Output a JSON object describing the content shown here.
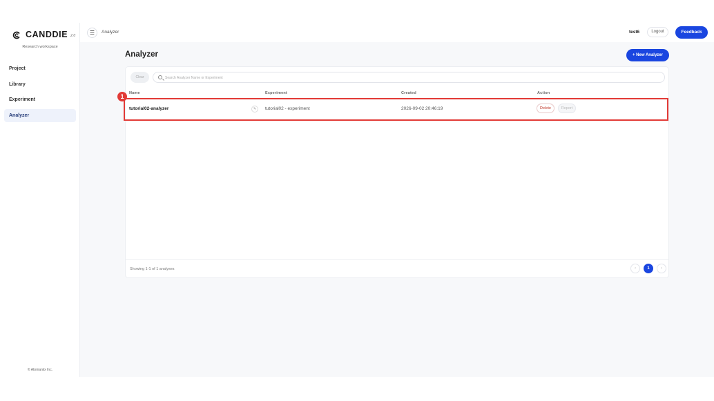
{
  "brand": {
    "name": "CANDDIE",
    "version": "2.0",
    "workspace": "Research workspace",
    "logo_icon": "canddie-logo-icon"
  },
  "sidebar": {
    "items": [
      {
        "label": "Project",
        "active": false
      },
      {
        "label": "Library",
        "active": false
      },
      {
        "label": "Experiment",
        "active": false
      },
      {
        "label": "Analyzer",
        "active": true
      }
    ],
    "copyright": "© Atomaniix Inc."
  },
  "header": {
    "menu_icon": "hamburger-menu-icon",
    "breadcrumb": "Analyzer",
    "username": "test6",
    "logout_label": "Logout",
    "feedback_label": "Feedback"
  },
  "main": {
    "title": "Analyzer",
    "new_button_label": "+ New Analyzer",
    "toolbar": {
      "clear_label": "Clear",
      "search_placeholder": "Search Analyzer Name or Experiment",
      "search_value": ""
    },
    "table": {
      "columns": [
        "Name",
        "Experiment",
        "Created",
        "Action"
      ],
      "rows": [
        {
          "name": "tutorial02-analyzer",
          "experiment": "tutorial02 - experiment",
          "created": "2026-09-02 20:46:19",
          "delete_label": "Delete",
          "report_label": "Report"
        }
      ]
    },
    "annotation_badge": "1",
    "footer": {
      "showing": "Showing 1-1 of 1 analyses",
      "prev": "‹",
      "current_page": "1",
      "next": "›"
    }
  },
  "colors": {
    "accent": "#1a46e0",
    "highlight": "#e23a36",
    "active_nav_bg": "#eef2fb"
  }
}
